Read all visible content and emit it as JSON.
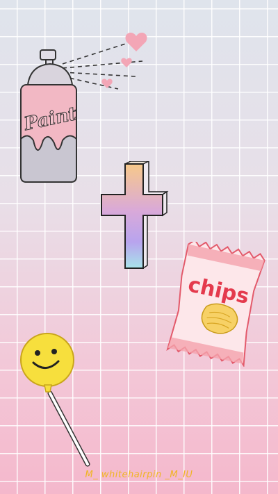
{
  "wallpaper": {
    "stickers": {
      "spray_can": {
        "icon": "spray-paint-can-icon",
        "label": "Paint",
        "colors": {
          "can": "#f2b8c4",
          "drip": "#c9c6d1"
        }
      },
      "cross": {
        "icon": "gradient-cross-icon",
        "colors": [
          "#f7c98a",
          "#c9a2e8",
          "#a8e3ea"
        ]
      },
      "chips_bag": {
        "icon": "chips-bag-icon",
        "label": "chips",
        "colors": {
          "bag": "#f06b7b",
          "chip": "#f7d166"
        }
      },
      "lollipop": {
        "icon": "smiley-lollipop-icon",
        "colors": {
          "candy": "#f7df3d"
        }
      }
    },
    "watermark": "M_ whitehairpin _M_IU",
    "colors": {
      "grid": "#ffffff",
      "watermark": "#f0b521"
    }
  }
}
